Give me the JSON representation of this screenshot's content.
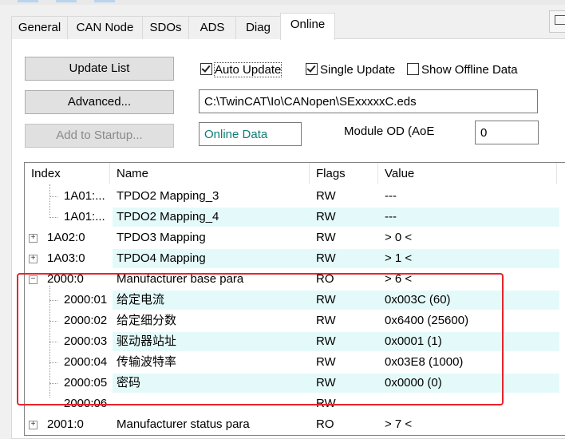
{
  "tabs": [
    {
      "label": "General"
    },
    {
      "label": "CAN Node"
    },
    {
      "label": "SDOs"
    },
    {
      "label": "ADS"
    },
    {
      "label": "Diag"
    },
    {
      "label": "Online"
    }
  ],
  "buttons": {
    "update_list": "Update List",
    "advanced": "Advanced...",
    "add_to_startup": "Add to Startup..."
  },
  "checkboxes": {
    "auto_update": {
      "label": "Auto Update",
      "checked": true
    },
    "single_update": {
      "label": "Single Update",
      "checked": true
    },
    "show_offline": {
      "label": "Show Offline Data",
      "checked": false
    }
  },
  "eds_path": "C:\\TwinCAT\\Io\\CANopen\\SExxxxxC.eds",
  "online_data_label": "Online Data",
  "module_od_label": "Module OD (AoE",
  "module_od_value": "0",
  "columns": {
    "index": "Index",
    "name": "Name",
    "flags": "Flags",
    "value": "Value"
  },
  "rows": [
    {
      "index": "1A01:...",
      "name": "TPDO2 Mapping_3",
      "flags": "RW",
      "value": "---"
    },
    {
      "index": "1A01:...",
      "name": "TPDO2 Mapping_4",
      "flags": "RW",
      "value": "---"
    },
    {
      "index": "1A02:0",
      "name": "TPDO3 Mapping",
      "flags": "RW",
      "value": "> 0 <"
    },
    {
      "index": "1A03:0",
      "name": "TPDO4 Mapping",
      "flags": "RW",
      "value": "> 1 <"
    },
    {
      "index": "2000:0",
      "name": "Manufacturer base para",
      "flags": "RO",
      "value": "> 6 <"
    },
    {
      "index": "2000:01",
      "name": "给定电流",
      "flags": "RW",
      "value": "0x003C (60)"
    },
    {
      "index": "2000:02",
      "name": "给定细分数",
      "flags": "RW",
      "value": "0x6400 (25600)"
    },
    {
      "index": "2000:03",
      "name": "驱动器站址",
      "flags": "RW",
      "value": "0x0001 (1)"
    },
    {
      "index": "2000:04",
      "name": "传输波特率",
      "flags": "RW",
      "value": "0x03E8 (1000)"
    },
    {
      "index": "2000:05",
      "name": "密码",
      "flags": "RW",
      "value": "0x0000 (0)"
    },
    {
      "index": "2000:06",
      "name": "",
      "flags": "RW",
      "value": ""
    },
    {
      "index": "2001:0",
      "name": "Manufacturer status para",
      "flags": "RO",
      "value": "> 7 <"
    }
  ],
  "colors": {
    "row_highlight": "#e4fafa",
    "annotation_box": "#e8232a",
    "online_data_text": "#0f7d77"
  }
}
